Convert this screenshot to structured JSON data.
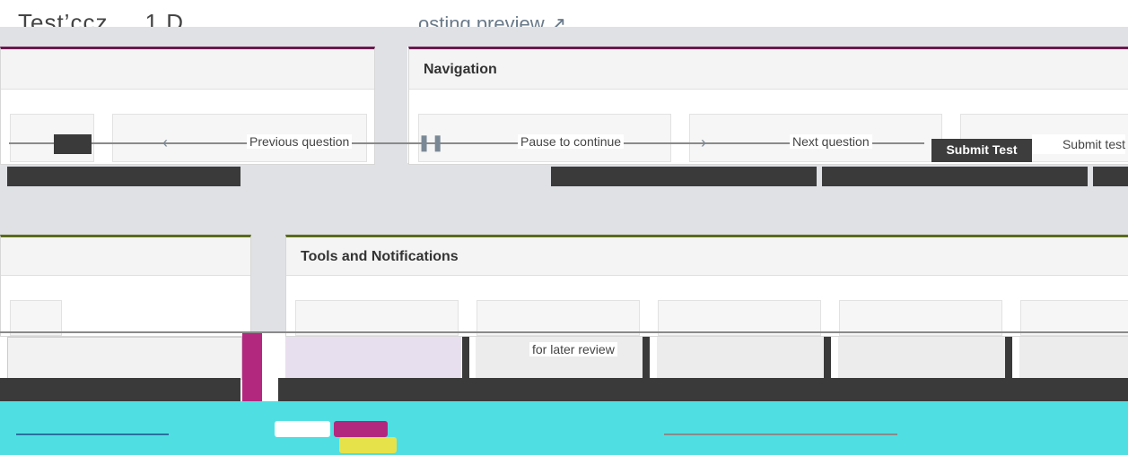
{
  "header": {
    "title": "Test’ccz ... 1 D",
    "subtitle": "osting preview ↗"
  },
  "navigation": {
    "title": "Navigation",
    "previous_label": "Previous question",
    "pause_label": "Pause to continue",
    "next_label": "Next question",
    "submit_button_label": "Submit Test",
    "submit_link_label": "Submit test"
  },
  "tools": {
    "title": "Tools and Notifications",
    "flag_label": "for later review"
  },
  "colors": {
    "accent_nav": "#6b1a4f",
    "accent_tools": "#5a6b1a",
    "footer": "#4fdfe2",
    "magenta": "#b3287f"
  }
}
